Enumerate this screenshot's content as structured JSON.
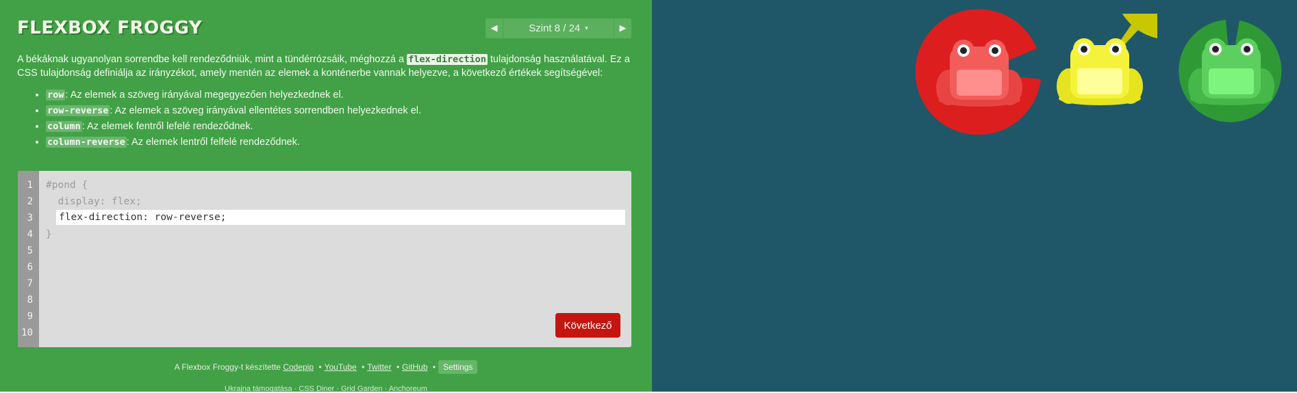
{
  "header": {
    "title": "FLEXBOX FROGGY",
    "level_indicator": "Szint 8 / 24",
    "prev_arrow": "◀",
    "next_arrow": "▶",
    "caret": "▾"
  },
  "instructions": {
    "text_before": "A békáknak ugyanolyan sorrendbe kell rendeződniük, mint a tündérrózsáik, méghozzá a ",
    "property": "flex-direction",
    "text_after": " tulajdonság használatával. Ez a CSS tulajdonság definiálja az irányzékot, amely mentén az elemek a konténerbe vannak helyezve, a következő értékek segítségével:"
  },
  "values": [
    {
      "code": "row",
      "desc": ": Az elemek a szöveg irányával megegyezően helyezkednek el."
    },
    {
      "code": "row-reverse",
      "desc": ": Az elemek a szöveg irányával ellentétes sorrendben helyezkednek el."
    },
    {
      "code": "column",
      "desc": ": Az elemek fentről lefelé rendeződnek."
    },
    {
      "code": "column-reverse",
      "desc": ": Az elemek lentről felfelé rendeződnek."
    }
  ],
  "editor": {
    "line_numbers": [
      "1",
      "2",
      "3",
      "4",
      "5",
      "6",
      "7",
      "8",
      "9",
      "10"
    ],
    "line1": "#pond {",
    "line2": "  display: flex;",
    "input_value": "flex-direction: row-reverse;",
    "line4": "}",
    "next_button": "Következő"
  },
  "footer": {
    "text": "A Flexbox Froggy-t készítette",
    "links": [
      "Codepip",
      "YouTube",
      "Twitter",
      "GitHub"
    ],
    "separator": "•",
    "settings": "Settings",
    "second_line": "Ukrajna támogatása · CSS Diner · Grid Garden · Anchoreum"
  },
  "pond": {
    "lilypads": [
      "red",
      "yellow",
      "green"
    ],
    "frogs": [
      "red",
      "yellow",
      "green"
    ],
    "colors": {
      "red_pad": "#dd1e1e",
      "red_frog": "#f25d5b",
      "yellow_pad": "#c9c700",
      "yellow_frog": "#f5f23c",
      "green_pad": "#2f9a35",
      "green_frog": "#5dcf5f",
      "background": "#1f5768"
    }
  }
}
